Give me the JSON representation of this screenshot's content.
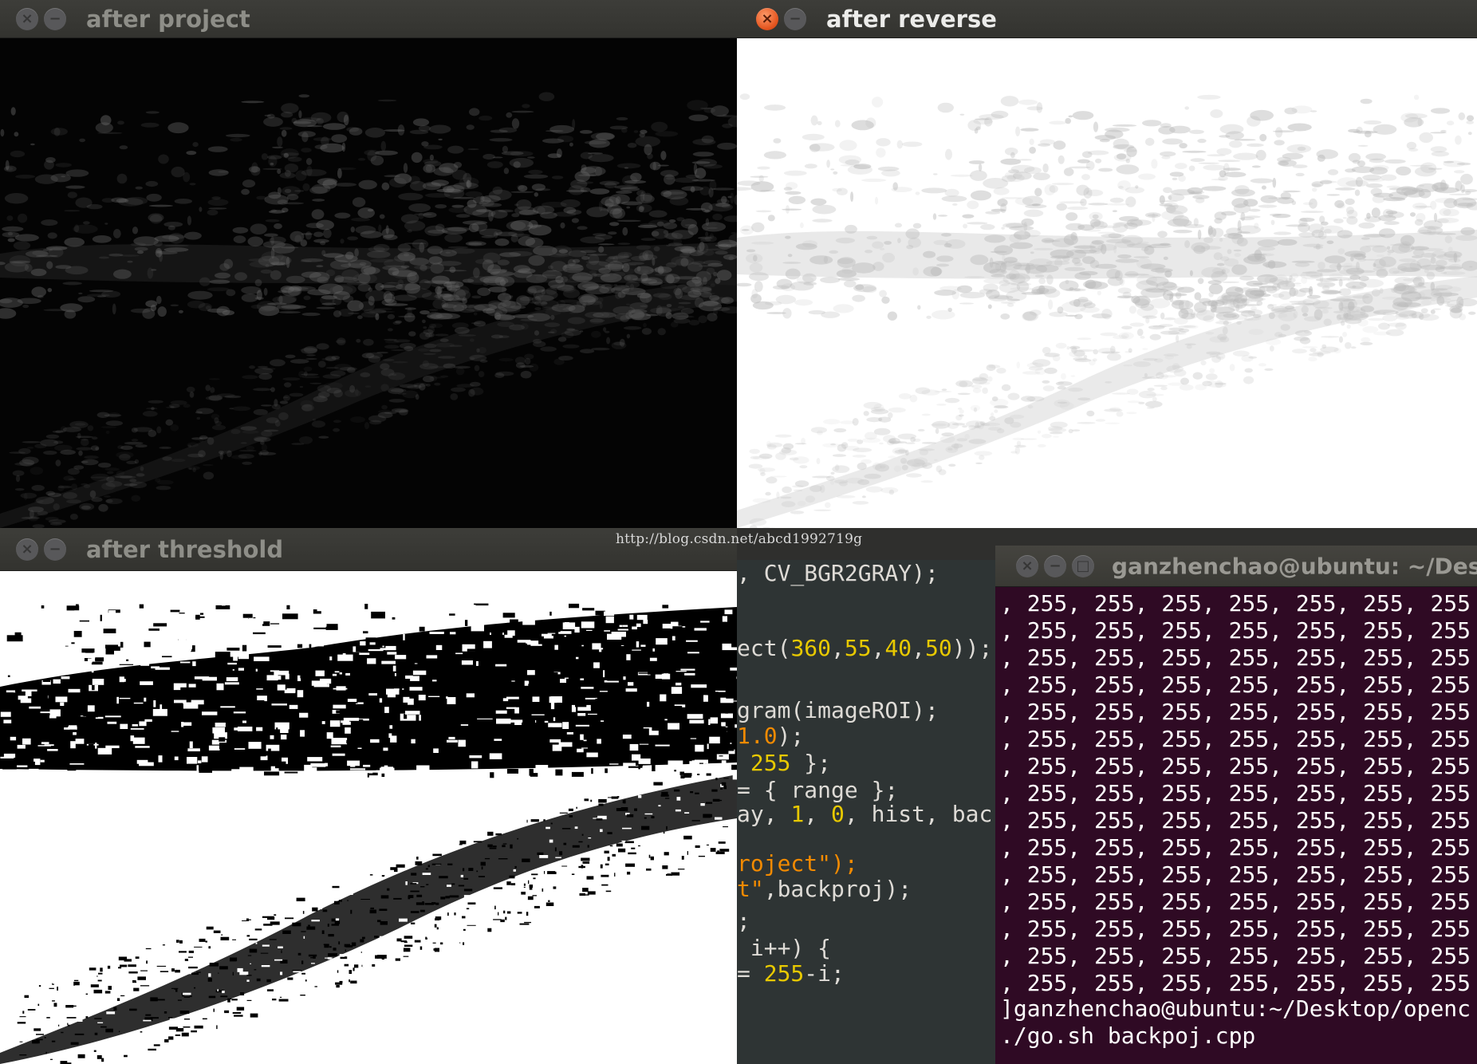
{
  "windows": {
    "project": {
      "title": "after project"
    },
    "reverse": {
      "title": "after reverse"
    },
    "threshold": {
      "title": "after threshold"
    }
  },
  "code_editor": {
    "lines": [
      {
        "segments": [
          {
            "text": ", CV_BGR2GRAY);",
            "color": "#dedbd6"
          }
        ]
      },
      {
        "segments": [
          {
            "text": "ect(",
            "color": "#dedbd6"
          },
          {
            "text": "360",
            "color": "#e8c900"
          },
          {
            "text": ",",
            "color": "#dedbd6"
          },
          {
            "text": "55",
            "color": "#e8c900"
          },
          {
            "text": ",",
            "color": "#dedbd6"
          },
          {
            "text": "40",
            "color": "#e8c900"
          },
          {
            "text": ",",
            "color": "#dedbd6"
          },
          {
            "text": "50",
            "color": "#e8c900"
          },
          {
            "text": "));",
            "color": "#dedbd6"
          }
        ]
      },
      {
        "segments": [
          {
            "text": "gram(imageROI);",
            "color": "#dedbd6"
          }
        ]
      },
      {
        "segments": [
          {
            "text": "1.0",
            "color": "#f28a00"
          },
          {
            "text": ");",
            "color": "#dedbd6"
          }
        ]
      },
      {
        "segments": [
          {
            "text": " ",
            "color": "#dedbd6"
          },
          {
            "text": "255",
            "color": "#e8c900"
          },
          {
            "text": " };",
            "color": "#dedbd6"
          }
        ]
      },
      {
        "segments": [
          {
            "text": "= { range };",
            "color": "#dedbd6"
          }
        ]
      },
      {
        "segments": [
          {
            "text": "ay, ",
            "color": "#dedbd6"
          },
          {
            "text": "1",
            "color": "#e8c900"
          },
          {
            "text": ", ",
            "color": "#dedbd6"
          },
          {
            "text": "0",
            "color": "#e8c900"
          },
          {
            "text": ", hist, bac",
            "color": "#dedbd6"
          }
        ]
      },
      {
        "segments": [
          {
            "text": "roject\");",
            "color": "#f28a00"
          }
        ]
      },
      {
        "segments": [
          {
            "text": "t\"",
            "color": "#f28a00"
          },
          {
            "text": ",backproj);",
            "color": "#dedbd6"
          }
        ]
      },
      {
        "segments": [
          {
            "text": ";",
            "color": "#dedbd6"
          }
        ]
      },
      {
        "segments": [
          {
            "text": " i++) {",
            "color": "#dedbd6"
          }
        ]
      },
      {
        "segments": [
          {
            "text": "= ",
            "color": "#dedbd6"
          },
          {
            "text": "255",
            "color": "#e8c900"
          },
          {
            "text": "-i;",
            "color": "#dedbd6"
          }
        ]
      }
    ]
  },
  "terminal": {
    "title": "ganzhenchao@ubuntu: ~/Desktop",
    "value_lines": [
      ", 255, 255, 255, 255, 255, 255, 255",
      ", 255, 255, 255, 255, 255, 255, 255",
      ", 255, 255, 255, 255, 255, 255, 255",
      ", 255, 255, 255, 255, 255, 255, 255",
      ", 255, 255, 255, 255, 255, 255, 255",
      ", 255, 255, 255, 255, 255, 255, 255",
      ", 255, 255, 255, 255, 255, 255, 255",
      ", 255, 255, 255, 255, 255, 255, 255",
      ", 255, 255, 255, 255, 255, 255, 255",
      ", 255, 255, 255, 255, 255, 255, 255",
      ", 255, 255, 255, 255, 255, 255, 255",
      ", 255, 255, 255, 255, 255, 255, 255",
      ", 255, 255, 255, 255, 255, 255, 255",
      ", 255, 255, 255, 255, 255, 255, 255",
      ", 255, 255, 255, 255, 255, 255, 255"
    ],
    "prompt": "]ganzhenchao@ubuntu:~/Desktop/openc",
    "command": "./go.sh backpoj.cpp"
  },
  "watermark": "http://blog.csdn.net/abcd1992719g",
  "colors": {
    "close_active": "#e4551f",
    "terminal_background": "#2f0a24",
    "editor_background": "#2e3434",
    "syntax_number": "#e8c900",
    "syntax_string": "#f28a00"
  }
}
